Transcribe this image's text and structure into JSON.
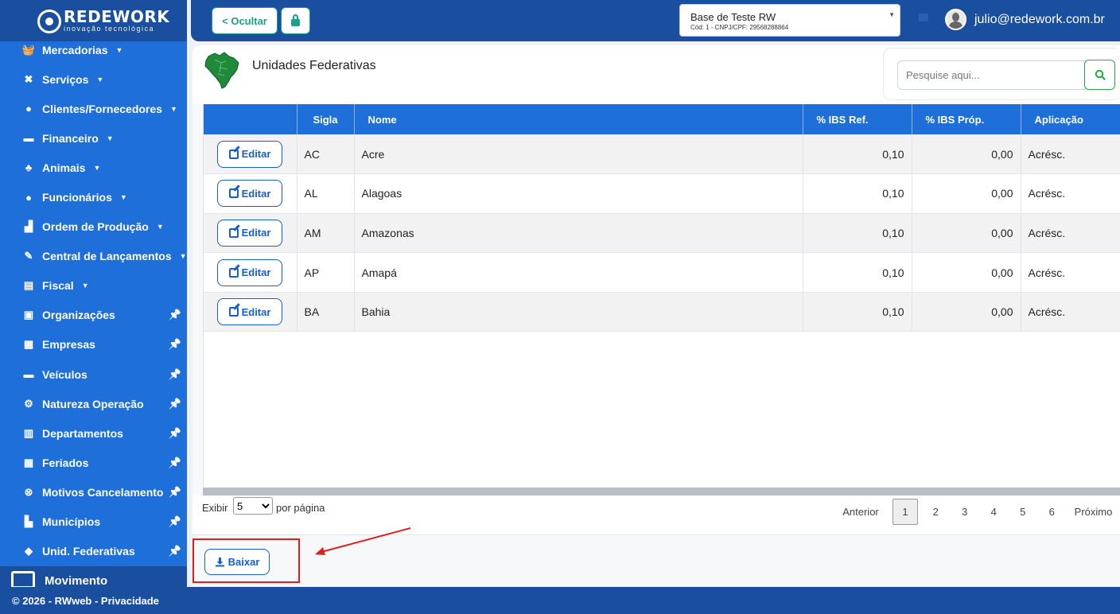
{
  "brand": {
    "name": "REDEWORK",
    "tagline": "inovação tecnológica"
  },
  "sidebar": {
    "items": [
      {
        "label": "Mercadorias",
        "icon": "basket-icon",
        "glyph": "🧺",
        "expandable": true
      },
      {
        "label": "Serviços",
        "icon": "tools-icon",
        "glyph": "✖",
        "expandable": true
      },
      {
        "label": "Clientes/Fornecedores",
        "icon": "user-icon",
        "glyph": "●",
        "expandable": true
      },
      {
        "label": "Financeiro",
        "icon": "money-icon",
        "glyph": "▬",
        "expandable": true
      },
      {
        "label": "Animais",
        "icon": "paw-icon",
        "glyph": "♣",
        "expandable": true
      },
      {
        "label": "Funcionários",
        "icon": "user-icon",
        "glyph": "●",
        "expandable": true
      },
      {
        "label": "Ordem de Produção",
        "icon": "industry-icon",
        "glyph": "▟",
        "expandable": true
      },
      {
        "label": "Central de Lançamentos",
        "icon": "edit-icon",
        "glyph": "✎",
        "expandable": true
      },
      {
        "label": "Fiscal",
        "icon": "receipt-icon",
        "glyph": "▤",
        "expandable": true
      },
      {
        "label": "Organizações",
        "icon": "briefcase-icon",
        "glyph": "▣",
        "pinned": true
      },
      {
        "label": "Empresas",
        "icon": "warehouse-icon",
        "glyph": "▦",
        "pinned": true
      },
      {
        "label": "Veículos",
        "icon": "car-icon",
        "glyph": "▬",
        "pinned": true
      },
      {
        "label": "Natureza Operação",
        "icon": "cogs-icon",
        "glyph": "⚙",
        "pinned": true
      },
      {
        "label": "Departamentos",
        "icon": "building-icon",
        "glyph": "▥",
        "pinned": true
      },
      {
        "label": "Feriados",
        "icon": "calendar-icon",
        "glyph": "▦",
        "pinned": true
      },
      {
        "label": "Motivos Cancelamento",
        "icon": "cancel-circle-icon",
        "glyph": "⊗",
        "pinned": true
      },
      {
        "label": "Municípios",
        "icon": "city-icon",
        "glyph": "▙",
        "pinned": true
      },
      {
        "label": "Unid. Federativas",
        "icon": "map-marker-icon",
        "glyph": "◆",
        "pinned": true
      }
    ],
    "movimento": "Movimento"
  },
  "header": {
    "hide_label": "< Ocultar",
    "company_name": "Base de Teste RW",
    "company_sub": "Cód: 1 - CNPJ/CPF: 29568288864",
    "user_email": "julio@redework.com.br"
  },
  "page": {
    "title": "Unidades Federativas",
    "search_placeholder": "Pesquise aqui..."
  },
  "table": {
    "columns": [
      "",
      "Sigla",
      "Nome",
      "% IBS Ref.",
      "% IBS Próp.",
      "Aplicação"
    ],
    "edit_label": "Editar",
    "rows": [
      {
        "sigla": "AC",
        "nome": "Acre",
        "ibs_ref": "0,10",
        "ibs_prop": "0,00",
        "aplicacao": "Acrésc."
      },
      {
        "sigla": "AL",
        "nome": "Alagoas",
        "ibs_ref": "0,10",
        "ibs_prop": "0,00",
        "aplicacao": "Acrésc."
      },
      {
        "sigla": "AM",
        "nome": "Amazonas",
        "ibs_ref": "0,10",
        "ibs_prop": "0,00",
        "aplicacao": "Acrésc."
      },
      {
        "sigla": "AP",
        "nome": "Amapá",
        "ibs_ref": "0,10",
        "ibs_prop": "0,00",
        "aplicacao": "Acrésc."
      },
      {
        "sigla": "BA",
        "nome": "Bahia",
        "ibs_ref": "0,10",
        "ibs_prop": "0,00",
        "aplicacao": "Acrésc."
      }
    ]
  },
  "pagination": {
    "show_label": "Exibir",
    "per_page": "5",
    "per_page_label": "por página",
    "prev": "Anterior",
    "pages": [
      "1",
      "2",
      "3",
      "4",
      "5",
      "6"
    ],
    "active_page": "1",
    "next": "Próximo"
  },
  "actions": {
    "download_label": "Baixar"
  },
  "footer": {
    "text": "© 2026 - RWweb - Privacidade"
  },
  "colors": {
    "sidebar": "#1e6fd9",
    "header": "#1a4fa0",
    "accent_teal": "#1e9e8a",
    "table_header": "#1e6fd9",
    "highlight_red": "#e02020"
  }
}
